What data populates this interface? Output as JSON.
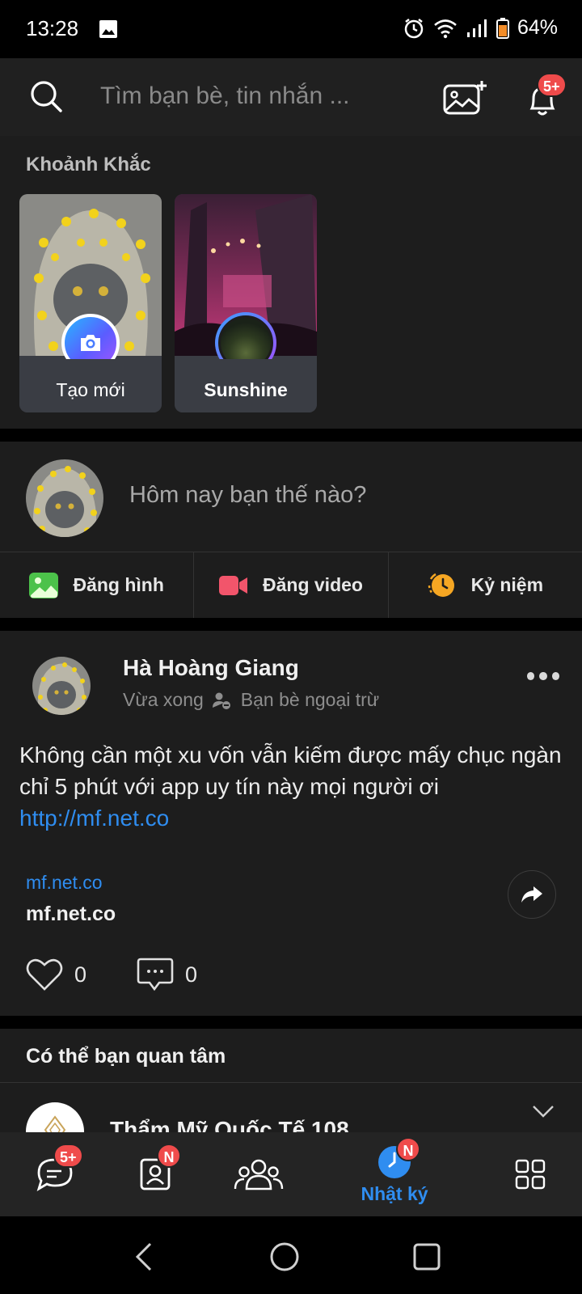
{
  "status_bar": {
    "time": "13:28",
    "battery": "64%"
  },
  "top_bar": {
    "search_placeholder": "Tìm bạn bè, tin nhắn ...",
    "notification_badge": "5+"
  },
  "moments": {
    "title": "Khoảnh Khắc",
    "create_label": "Tạo mới",
    "friend_label": "Sunshine"
  },
  "compose": {
    "prompt": "Hôm nay bạn thế nào?",
    "actions": [
      {
        "label": "Đăng hình",
        "icon": "image-icon"
      },
      {
        "label": "Đăng video",
        "icon": "video-icon"
      },
      {
        "label": "Kỷ niệm",
        "icon": "memory-clock-icon"
      }
    ]
  },
  "post": {
    "author": "Hà Hoàng Giang",
    "time": "Vừa xong",
    "privacy": "Bạn bè ngoại trừ",
    "text": "Không cần một xu vốn vẫn kiếm được mấy chục ngàn chỉ 5 phút với app uy tín này mọi người ơi",
    "link": "http://mf.net.co",
    "preview_domain": "mf.net.co",
    "preview_title": "mf.net.co",
    "likes": "0",
    "comments": "0"
  },
  "suggest": {
    "title": "Có thể bạn quan tâm",
    "first_name": "Thẩm Mỹ Quốc Tế 108"
  },
  "bottom_nav": {
    "messages_badge": "5+",
    "contacts_badge": "N",
    "timeline_badge": "N",
    "timeline_label": "Nhật ký"
  },
  "colors": {
    "accent": "#2f8df0",
    "badge": "#ef4b4b",
    "background": "#1d1d1d"
  }
}
